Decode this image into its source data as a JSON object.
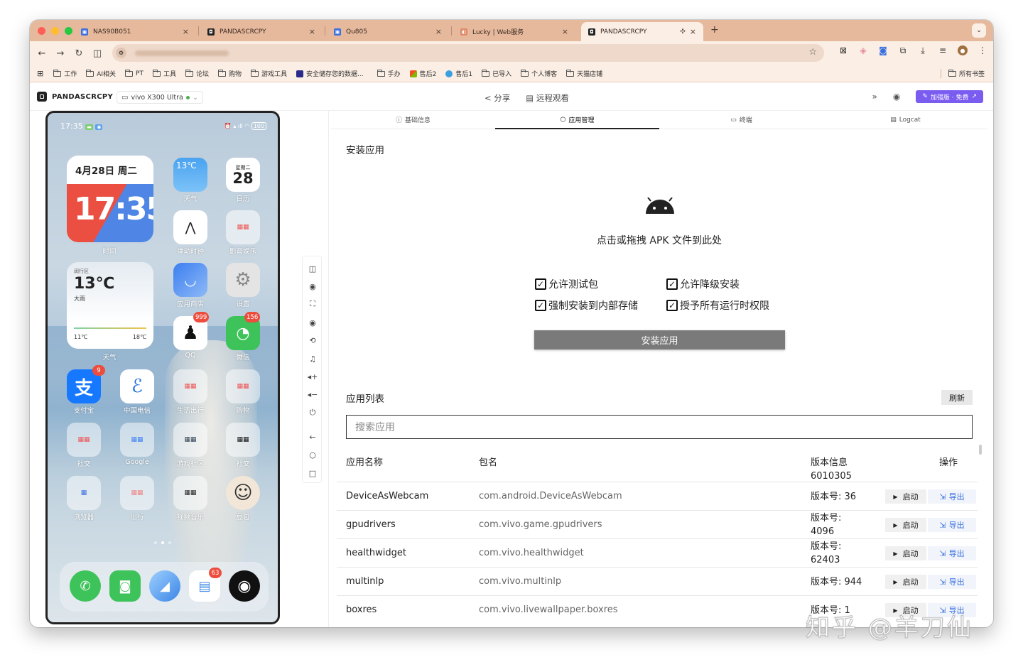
{
  "browser": {
    "tabs": [
      {
        "label": "NAS90B051",
        "fav_color": "#3a6fe0",
        "active": false
      },
      {
        "label": "PANDASCRCPY",
        "fav_color": "#222222",
        "active": false
      },
      {
        "label": "Qu805",
        "fav_color": "#3a6fe0",
        "active": false
      },
      {
        "label": "Lucky | Web服务",
        "fav_color": "#e05a3a",
        "active": false
      },
      {
        "label": "PANDASCRCPY",
        "fav_color": "#222222",
        "active": true
      }
    ],
    "bookmarks": [
      {
        "label": "工作",
        "type": "folder"
      },
      {
        "label": "AI相关",
        "type": "folder"
      },
      {
        "label": "PT",
        "type": "folder"
      },
      {
        "label": "工具",
        "type": "folder"
      },
      {
        "label": "论坛",
        "type": "folder"
      },
      {
        "label": "购物",
        "type": "folder"
      },
      {
        "label": "游戏工具",
        "type": "folder"
      },
      {
        "label": "安全储存您的数据...",
        "type": "site",
        "color": "#2a2a8a"
      },
      {
        "label": "手办",
        "type": "folder"
      },
      {
        "label": "售后2",
        "type": "site",
        "color": "#f2a000"
      },
      {
        "label": "售后1",
        "type": "site",
        "color": "#3aa0e0"
      },
      {
        "label": "已导入",
        "type": "folder"
      },
      {
        "label": "个人博客",
        "type": "folder"
      },
      {
        "label": "天猫店铺",
        "type": "folder"
      }
    ],
    "all_bookmarks": "所有书签"
  },
  "app": {
    "brand": "PANDASCRCPY",
    "device": "vivo X300 Ultra",
    "share": "分享",
    "remote": "远程观看",
    "plus_label": "加强版 · 免费"
  },
  "phone": {
    "time": "17:35",
    "battery": "100",
    "date": "4月28日 周二",
    "clock": "17:35",
    "clock_label": "时间",
    "weather_small": "13℃",
    "weather_label": "天气",
    "cal_day": "28",
    "cal_week": "星期二",
    "cal_label": "日历",
    "clock_app": "律动时钟",
    "video_folder": "影音娱乐",
    "w_location": "闵行区",
    "w_temp": "13℃",
    "w_cond": "大雨",
    "w_low": "11℃",
    "w_high": "18℃",
    "w_label": "天气",
    "appstore": "应用商店",
    "settings": "设置",
    "qq": "QQ",
    "qq_badge": "999",
    "wechat": "微信",
    "wechat_badge": "156",
    "alipay": "支付宝",
    "alipay_badge": "9",
    "telecom": "中国电信",
    "life": "生活出行",
    "shop": "购物",
    "social": "社交",
    "google": "Google",
    "gamecom": "游戏社区",
    "social2": "社交",
    "browser": "浏览器",
    "travel": "出行",
    "vmusic": "视频音乐",
    "doubao": "豆包",
    "msg_badge": "63"
  },
  "panel": {
    "subtabs": [
      "基础信息",
      "应用管理",
      "终端",
      "Logcat"
    ],
    "install_title": "安装应用",
    "drop_text": "点击或拖拽 APK 文件到此处",
    "options": [
      "允许测试包",
      "允许降级安装",
      "强制安装到内部存储",
      "授予所有运行时权限"
    ],
    "install_btn": "安装应用",
    "list_title": "应用列表",
    "refresh": "刷新",
    "search_placeholder": "搜索应用",
    "col_name": "应用名称",
    "col_pkg": "包名",
    "col_ver": "版本信息",
    "col_op": "操作",
    "partial_ver": "6010305",
    "btn_start": "启动",
    "btn_export": "导出",
    "rows": [
      {
        "name": "DeviceAsWebcam",
        "pkg": "com.android.DeviceAsWebcam",
        "ver": "版本号: 36"
      },
      {
        "name": "gpudrivers",
        "pkg": "com.vivo.game.gpudrivers",
        "ver": "版本号:\n4096"
      },
      {
        "name": "healthwidget",
        "pkg": "com.vivo.healthwidget",
        "ver": "版本号:\n62403"
      },
      {
        "name": "multinlp",
        "pkg": "com.vivo.multinlp",
        "ver": "版本号: 944"
      },
      {
        "name": "boxres",
        "pkg": "com.vivo.livewallpaper.boxres",
        "ver": "版本号: 1"
      }
    ]
  },
  "watermark": "知乎 @羊刀仙"
}
